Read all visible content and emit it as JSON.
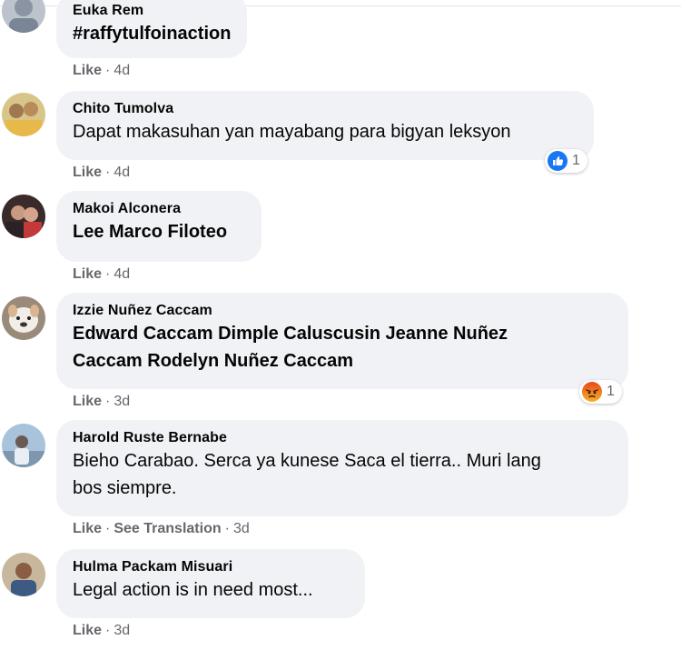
{
  "comments": [
    {
      "author": "Euka Rem",
      "text": "#raffytulfoinaction",
      "like": "Like",
      "time": "4d",
      "avatar_icon": "profile-photo-icon"
    },
    {
      "author": "Chito Tumolva",
      "text": "Dapat makasuhan yan mayabang para bigyan leksyon",
      "like": "Like",
      "time": "4d",
      "avatar_icon": "profile-photo-icon",
      "reaction": {
        "icon": "like-reaction-icon",
        "count": "1",
        "color": "#1877f2"
      }
    },
    {
      "author": "Makoi Alconera",
      "text": "Lee Marco Filoteo",
      "like": "Like",
      "time": "4d",
      "avatar_icon": "profile-photo-icon"
    },
    {
      "author": "Izzie Nuñez Caccam",
      "text_line1": "Edward Caccam Dimple Caluscusin Jeanne Nuñez",
      "text_line2": "Caccam Rodelyn Nuñez Caccam",
      "like": "Like",
      "time": "3d",
      "avatar_icon": "profile-photo-icon",
      "reaction": {
        "icon": "angry-reaction-icon",
        "count": "1",
        "color": "#f7714b"
      }
    },
    {
      "author": "Harold Ruste Bernabe",
      "text_line1": "Bieho Carabao. Serca ya kunese Saca el tierra.. Muri lang",
      "text_line2": "bos siempre.",
      "like": "Like",
      "see_translation": "See Translation",
      "time": "3d",
      "avatar_icon": "profile-photo-icon"
    },
    {
      "author": "Hulma Packam Misuari",
      "text": "Legal action is in need most...",
      "like": "Like",
      "time": "3d",
      "avatar_icon": "profile-photo-icon"
    }
  ],
  "separator": "·"
}
